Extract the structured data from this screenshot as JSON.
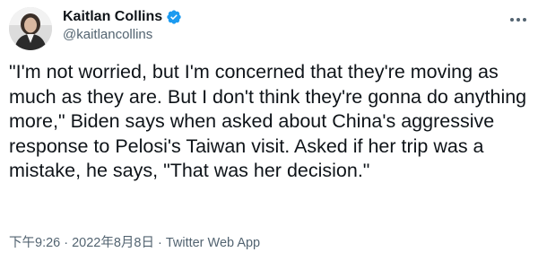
{
  "author": {
    "name": "Kaitlan Collins",
    "handle": "@kaitlancollins",
    "verified": true
  },
  "icons": {
    "verified": "verified-badge-icon",
    "more": "more-options-icon",
    "avatar": "profile-photo"
  },
  "colors": {
    "text": "#0f1419",
    "secondary": "#536471",
    "verified_blue": "#1d9bf0"
  },
  "tweet": {
    "text": "\"I'm not worried, but I'm concerned that they're moving as much as they are. But I don't think they're gonna do anything more,\" Biden says when asked about China's aggressive response to Pelosi's Taiwan visit. Asked if her trip was a mistake, he says, \"That was her decision.\""
  },
  "meta": {
    "time": "下午9:26",
    "separator": "·",
    "date": "2022年8月8日",
    "source": "Twitter Web App"
  }
}
